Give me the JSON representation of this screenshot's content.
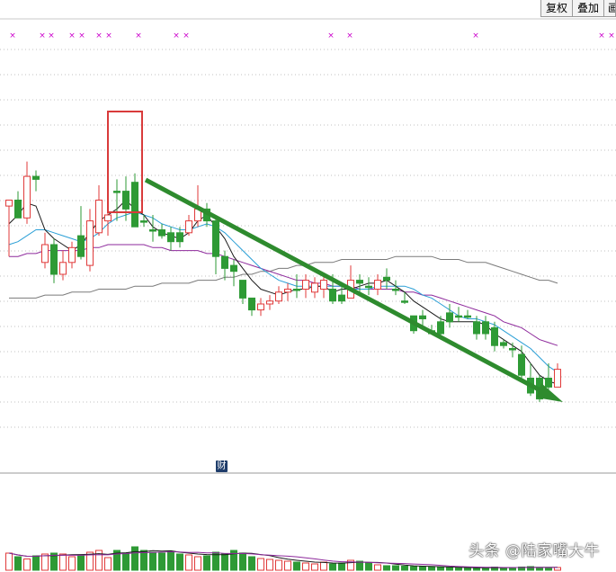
{
  "toolbar": {
    "restore_rights_label": "复权",
    "overlay_label": "叠加",
    "more_label": "画"
  },
  "badge": {
    "finance_label": "财"
  },
  "watermark": {
    "text": "头条 @陆家嘴大牛"
  },
  "colors": {
    "up": "#e03a3a",
    "down": "#2e9a35",
    "ma_short": "#1a1a1a",
    "ma_mid": "#2a9fd6",
    "ma_long": "#8e2a9c",
    "ma_xlong": "#7a7a7a",
    "arrow": "#2e8b2e",
    "highlight_box": "#d93b3b",
    "marker": "#cc00cc",
    "grid": "#c0c0c0"
  },
  "chart_data": {
    "type": "candlestick",
    "price_range": [
      0,
      100
    ],
    "volume_range": [
      0,
      100
    ],
    "candles": [
      {
        "o": 27,
        "c": 25,
        "h": 26,
        "l": 44
      },
      {
        "o": 25,
        "c": 31,
        "h": 22,
        "l": 31
      },
      {
        "o": 31,
        "c": 17,
        "h": 12,
        "l": 33
      },
      {
        "o": 17,
        "c": 18,
        "h": 15,
        "l": 22
      },
      {
        "o": 46,
        "c": 40,
        "h": 36,
        "l": 48
      },
      {
        "o": 40,
        "c": 50,
        "h": 38,
        "l": 53
      },
      {
        "o": 50,
        "c": 46,
        "h": 42,
        "l": 52
      },
      {
        "o": 46,
        "c": 41,
        "h": 39,
        "l": 48
      },
      {
        "o": 37,
        "c": 44,
        "h": 27,
        "l": 45
      },
      {
        "o": 47,
        "c": 32,
        "h": 28,
        "l": 49
      },
      {
        "o": 36,
        "c": 25,
        "h": 20,
        "l": 37
      },
      {
        "o": 32,
        "c": 30,
        "h": 28,
        "l": 37
      },
      {
        "o": 22,
        "c": 22,
        "h": 18,
        "l": 32
      },
      {
        "o": 22,
        "c": 28,
        "h": 17,
        "l": 32
      },
      {
        "o": 19,
        "c": 34,
        "h": 16,
        "l": 34
      },
      {
        "o": 32,
        "c": 32,
        "h": 30,
        "l": 34
      },
      {
        "o": 35,
        "c": 35,
        "h": 30,
        "l": 39
      },
      {
        "o": 35,
        "c": 37,
        "h": 33,
        "l": 38
      },
      {
        "o": 36,
        "c": 39,
        "h": 34,
        "l": 42
      },
      {
        "o": 36,
        "c": 39,
        "h": 34,
        "l": 41
      },
      {
        "o": 36,
        "c": 32,
        "h": 30,
        "l": 37
      },
      {
        "o": 32,
        "c": 28,
        "h": 20,
        "l": 34
      },
      {
        "o": 28,
        "c": 32,
        "h": 26,
        "l": 34
      },
      {
        "o": 32,
        "c": 44,
        "h": 30,
        "l": 50
      },
      {
        "o": 44,
        "c": 48,
        "h": 42,
        "l": 52
      },
      {
        "o": 47,
        "c": 49,
        "h": 45,
        "l": 54
      },
      {
        "o": 52,
        "c": 58,
        "h": 52,
        "l": 60
      },
      {
        "o": 58,
        "c": 62,
        "h": 58,
        "l": 64
      },
      {
        "o": 62,
        "c": 60,
        "h": 58,
        "l": 64
      },
      {
        "o": 60,
        "c": 59,
        "h": 57,
        "l": 62
      },
      {
        "o": 59,
        "c": 56,
        "h": 54,
        "l": 60
      },
      {
        "o": 56,
        "c": 55,
        "h": 53,
        "l": 59
      },
      {
        "o": 55,
        "c": 55,
        "h": 50,
        "l": 58
      },
      {
        "o": 55,
        "c": 52,
        "h": 50,
        "l": 58
      },
      {
        "o": 56,
        "c": 53,
        "h": 51,
        "l": 58
      },
      {
        "o": 55,
        "c": 52,
        "h": 50,
        "l": 58
      },
      {
        "o": 55,
        "c": 59,
        "h": 50,
        "l": 60
      },
      {
        "o": 57,
        "c": 59,
        "h": 54,
        "l": 60
      },
      {
        "o": 58,
        "c": 52,
        "h": 47,
        "l": 58
      },
      {
        "o": 52,
        "c": 53,
        "h": 50,
        "l": 56
      },
      {
        "o": 54,
        "c": 54,
        "h": 51,
        "l": 57
      },
      {
        "o": 55,
        "c": 52,
        "h": 50,
        "l": 57
      },
      {
        "o": 51,
        "c": 52,
        "h": 48,
        "l": 55
      },
      {
        "o": 55,
        "c": 55,
        "h": 52,
        "l": 57
      },
      {
        "o": 59,
        "c": 59,
        "h": 56,
        "l": 60
      },
      {
        "o": 64,
        "c": 69,
        "h": 64,
        "l": 70
      },
      {
        "o": 64,
        "c": 65,
        "h": 62,
        "l": 68
      },
      {
        "o": 69,
        "c": 70,
        "h": 67,
        "l": 70
      },
      {
        "o": 66,
        "c": 70,
        "h": 64,
        "l": 72
      },
      {
        "o": 63,
        "c": 66,
        "h": 60,
        "l": 68
      },
      {
        "o": 64,
        "c": 64,
        "h": 61,
        "l": 66
      },
      {
        "o": 64,
        "c": 64,
        "h": 62,
        "l": 65
      },
      {
        "o": 66,
        "c": 70,
        "h": 64,
        "l": 72
      },
      {
        "o": 66,
        "c": 70,
        "h": 64,
        "l": 72
      },
      {
        "o": 68,
        "c": 74,
        "h": 66,
        "l": 76
      },
      {
        "o": 73,
        "c": 74,
        "h": 72,
        "l": 75
      },
      {
        "o": 75,
        "c": 75,
        "h": 73,
        "l": 78
      },
      {
        "o": 77,
        "c": 84,
        "h": 74,
        "l": 85
      },
      {
        "o": 85,
        "c": 90,
        "h": 80,
        "l": 91
      },
      {
        "o": 85,
        "c": 92,
        "h": 84,
        "l": 93
      },
      {
        "o": 85,
        "c": 88,
        "h": 80,
        "l": 90
      },
      {
        "o": 88,
        "c": 82,
        "h": 80,
        "l": 88
      }
    ],
    "volume": [
      38,
      30,
      25,
      32,
      36,
      38,
      36,
      30,
      34,
      40,
      44,
      28,
      44,
      38,
      52,
      44,
      40,
      38,
      42,
      36,
      34,
      30,
      32,
      40,
      36,
      44,
      38,
      30,
      26,
      24,
      22,
      20,
      18,
      16,
      14,
      18,
      14,
      16,
      22,
      20,
      16,
      12,
      10,
      10,
      9,
      8,
      8,
      7,
      7,
      6,
      5,
      5,
      5,
      6,
      7,
      5,
      6,
      7,
      8,
      6,
      5,
      6
    ],
    "xa": [
      10,
      20,
      30,
      40,
      50,
      60,
      70,
      80,
      90,
      100,
      110,
      120,
      130,
      140,
      150,
      160,
      170,
      180,
      190,
      200,
      210,
      220,
      230,
      240,
      250,
      260,
      270,
      280,
      290,
      300,
      310,
      320,
      330,
      340,
      350,
      360,
      370,
      380,
      390,
      400,
      410,
      420,
      430,
      440,
      450,
      460,
      470,
      480,
      490,
      500,
      510,
      520,
      530,
      540,
      550,
      560,
      570,
      580,
      590,
      600,
      610,
      620
    ],
    "ma_short_series": [
      33,
      30,
      26,
      27,
      35,
      38,
      40,
      42,
      40,
      36,
      32,
      30,
      28,
      25,
      28,
      30,
      34,
      36,
      37,
      38,
      36,
      32,
      30,
      34,
      38,
      44,
      48,
      52,
      55,
      56,
      57,
      56,
      55,
      55,
      54,
      54,
      56,
      55,
      55,
      54,
      53,
      53,
      52,
      54,
      56,
      59,
      61,
      63,
      65,
      66,
      66,
      66,
      66,
      67,
      70,
      72,
      74,
      76,
      80,
      84,
      86,
      87
    ],
    "ma_mid_series": [
      40,
      39,
      37,
      35,
      35,
      36,
      37,
      38,
      39,
      38,
      36,
      33,
      31,
      30,
      29,
      30,
      31,
      33,
      34,
      35,
      35,
      34,
      33,
      34,
      36,
      39,
      42,
      45,
      48,
      50,
      52,
      53,
      54,
      54,
      54,
      54,
      54,
      54,
      55,
      55,
      55,
      54,
      54,
      54,
      54,
      55,
      57,
      58,
      60,
      62,
      64,
      65,
      65,
      66,
      67,
      69,
      71,
      73,
      75,
      78,
      81,
      83
    ],
    "ma_long_series": [
      44,
      44,
      43,
      43,
      42,
      42,
      42,
      42,
      42,
      41,
      41,
      40,
      40,
      40,
      40,
      40,
      41,
      41,
      42,
      42,
      42,
      42,
      43,
      43,
      44,
      45,
      46,
      47,
      48,
      49,
      50,
      51,
      52,
      52,
      53,
      53,
      54,
      54,
      54,
      55,
      55,
      55,
      55,
      55,
      56,
      56,
      57,
      57,
      58,
      59,
      60,
      61,
      62,
      63,
      64,
      66,
      67,
      68,
      70,
      72,
      73,
      74
    ],
    "ma_xlong_series": [
      58,
      58,
      58,
      58,
      57,
      57,
      57,
      56,
      56,
      56,
      55,
      55,
      55,
      55,
      54,
      54,
      54,
      53,
      53,
      53,
      53,
      52,
      52,
      52,
      51,
      51,
      50,
      50,
      49,
      49,
      48,
      48,
      47,
      47,
      46,
      46,
      46,
      45,
      45,
      45,
      45,
      45,
      45,
      44,
      44,
      44,
      44,
      44,
      45,
      45,
      45,
      46,
      46,
      46,
      47,
      48,
      49,
      50,
      51,
      52,
      52,
      53
    ],
    "ylim": [
      0,
      100
    ]
  }
}
